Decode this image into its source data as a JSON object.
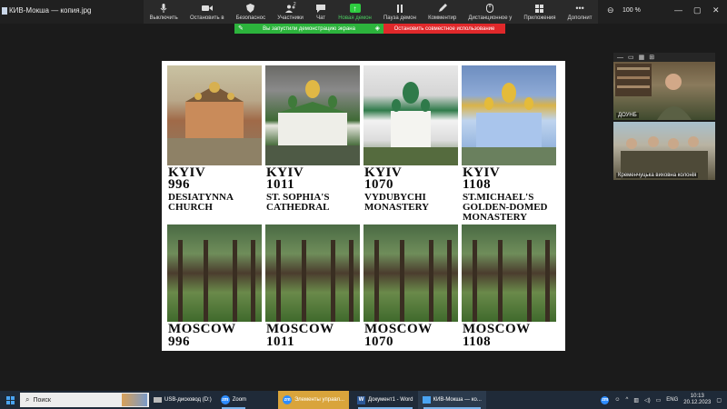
{
  "window": {
    "title": "КИВ-Мокша — копия.jpg",
    "zoom_level": "100 %"
  },
  "toolbar": {
    "items": [
      {
        "label": "Выключить",
        "icon": "microphone-icon"
      },
      {
        "label": "Остановить в",
        "icon": "camera-icon"
      },
      {
        "label": "Безопаснос",
        "icon": "shield-icon"
      },
      {
        "label": "Участники",
        "icon": "participants-icon",
        "count": "2"
      },
      {
        "label": "Чат",
        "icon": "chat-icon"
      },
      {
        "label": "Новая демон",
        "icon": "share-screen-icon",
        "active": true
      },
      {
        "label": "Пауза демон",
        "icon": "pause-icon"
      },
      {
        "label": "Комментир",
        "icon": "annotate-icon"
      },
      {
        "label": "Дистанционное у",
        "icon": "remote-control-icon"
      },
      {
        "label": "Приложения",
        "icon": "apps-icon"
      },
      {
        "label": "Дополнит",
        "icon": "more-icon"
      }
    ]
  },
  "share_bar": {
    "status": "Вы запустили демонстрацию экрана",
    "stop": "Остановить совместное использование"
  },
  "slide": {
    "kyiv": [
      {
        "city": "KYIV",
        "year": "996",
        "name": [
          "DESIATYNNA",
          "CHURCH"
        ]
      },
      {
        "city": "KYIV",
        "year": "1011",
        "name": [
          "ST. SOPHIA'S",
          "CATHEDRAL"
        ]
      },
      {
        "city": "KYIV",
        "year": "1070",
        "name": [
          "VYDUBYCHI",
          "MONASTERY"
        ]
      },
      {
        "city": "KYIV",
        "year": "1108",
        "name": [
          "ST.MICHAEL'S",
          "GOLDEN-DOMED",
          "MONASTERY"
        ]
      }
    ],
    "moscow": [
      {
        "city": "MOSCOW",
        "year": "996"
      },
      {
        "city": "MOSCOW",
        "year": "1011"
      },
      {
        "city": "MOSCOW",
        "year": "1070"
      },
      {
        "city": "MOSCOW",
        "year": "1108"
      }
    ]
  },
  "participants": [
    {
      "name": "ДОУНБ"
    },
    {
      "name": "Кременчуцька виховна колонія"
    }
  ],
  "taskbar": {
    "search_placeholder": "Поиск",
    "apps": [
      {
        "label": "USB-дисковод (D:)",
        "icon": "usb-drive-icon"
      },
      {
        "label": "Zoom",
        "icon": "zoom-icon"
      },
      {
        "label": "Элементы управл...",
        "icon": "zoom-icon",
        "highlight": true
      },
      {
        "label": "Документ1 - Word",
        "icon": "word-icon"
      },
      {
        "label": "КИВ-Мокша — ко...",
        "icon": "photos-icon"
      }
    ],
    "language": "ENG",
    "time": "10:13",
    "date": "20.12.2023"
  }
}
